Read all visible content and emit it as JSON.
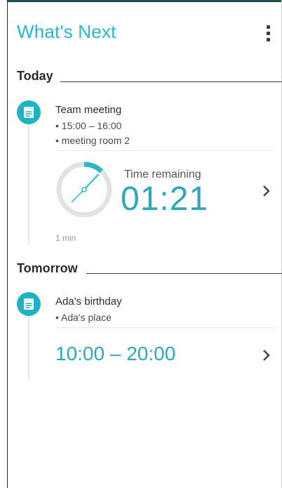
{
  "header": {
    "title": "What's Next"
  },
  "sections": [
    {
      "label": "Today",
      "event": {
        "title": "Team meeting",
        "details": [
          "• 15:00 – 16:00",
          "• meeting room 2"
        ],
        "countdown": {
          "label": "Time remaining",
          "value": "01:21",
          "progress": 0.12
        },
        "duration": "1 min"
      }
    },
    {
      "label": "Tomorrow",
      "event": {
        "title": "Ada's birthday",
        "details": [
          "• Ada's place"
        ],
        "time_range": "10:00 – 20:00"
      }
    }
  ],
  "colors": {
    "accent": "#29b6c8",
    "icon_bg": "#1fb2c4",
    "time_text": "#2ea7bd"
  },
  "icons": {
    "overflow": "more-vert-icon",
    "event": "calendar-icon",
    "chevron": "chevron-right-icon"
  }
}
